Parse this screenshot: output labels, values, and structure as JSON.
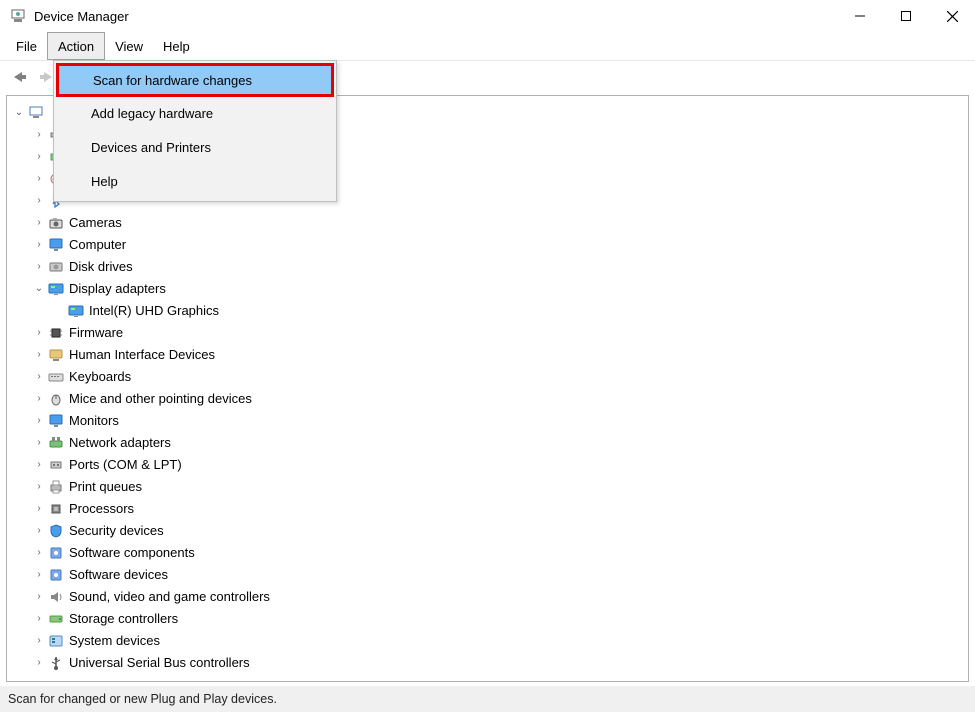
{
  "window": {
    "title": "Device Manager"
  },
  "menubar": {
    "items": [
      "File",
      "Action",
      "View",
      "Help"
    ],
    "open_index": 1
  },
  "dropdown": {
    "items": [
      {
        "label": "Scan for hardware changes",
        "selected": true
      },
      {
        "label": "Add legacy hardware",
        "selected": false
      },
      {
        "label": "Devices and Printers",
        "selected": false
      },
      {
        "label": "Help",
        "selected": false
      }
    ]
  },
  "tree": {
    "root": {
      "label": "",
      "expanded": true,
      "icon": "computer"
    },
    "nodes": [
      {
        "label": "",
        "icon": "audio",
        "expanded": false,
        "indent": 1
      },
      {
        "label": "",
        "icon": "battery",
        "expanded": false,
        "indent": 1
      },
      {
        "label": "",
        "icon": "biometric",
        "expanded": false,
        "indent": 1
      },
      {
        "label": "",
        "icon": "bluetooth",
        "expanded": false,
        "indent": 1
      },
      {
        "label": "Cameras",
        "icon": "camera",
        "expanded": false,
        "indent": 1
      },
      {
        "label": "Computer",
        "icon": "monitor",
        "expanded": false,
        "indent": 1
      },
      {
        "label": "Disk drives",
        "icon": "disk",
        "expanded": false,
        "indent": 1
      },
      {
        "label": "Display adapters",
        "icon": "display",
        "expanded": true,
        "indent": 1
      },
      {
        "label": "Intel(R) UHD Graphics",
        "icon": "display",
        "expanded": null,
        "indent": 2
      },
      {
        "label": "Firmware",
        "icon": "chip",
        "expanded": false,
        "indent": 1
      },
      {
        "label": "Human Interface Devices",
        "icon": "hid",
        "expanded": false,
        "indent": 1
      },
      {
        "label": "Keyboards",
        "icon": "keyboard",
        "expanded": false,
        "indent": 1
      },
      {
        "label": "Mice and other pointing devices",
        "icon": "mouse",
        "expanded": false,
        "indent": 1
      },
      {
        "label": "Monitors",
        "icon": "monitor",
        "expanded": false,
        "indent": 1
      },
      {
        "label": "Network adapters",
        "icon": "network",
        "expanded": false,
        "indent": 1
      },
      {
        "label": "Ports (COM & LPT)",
        "icon": "port",
        "expanded": false,
        "indent": 1
      },
      {
        "label": "Print queues",
        "icon": "printer",
        "expanded": false,
        "indent": 1
      },
      {
        "label": "Processors",
        "icon": "processor",
        "expanded": false,
        "indent": 1
      },
      {
        "label": "Security devices",
        "icon": "security",
        "expanded": false,
        "indent": 1
      },
      {
        "label": "Software components",
        "icon": "software",
        "expanded": false,
        "indent": 1
      },
      {
        "label": "Software devices",
        "icon": "software",
        "expanded": false,
        "indent": 1
      },
      {
        "label": "Sound, video and game controllers",
        "icon": "sound",
        "expanded": false,
        "indent": 1
      },
      {
        "label": "Storage controllers",
        "icon": "storage",
        "expanded": false,
        "indent": 1
      },
      {
        "label": "System devices",
        "icon": "system",
        "expanded": false,
        "indent": 1
      },
      {
        "label": "Universal Serial Bus controllers",
        "icon": "usb",
        "expanded": false,
        "indent": 1
      }
    ]
  },
  "statusbar": {
    "text": "Scan for changed or new Plug and Play devices."
  }
}
